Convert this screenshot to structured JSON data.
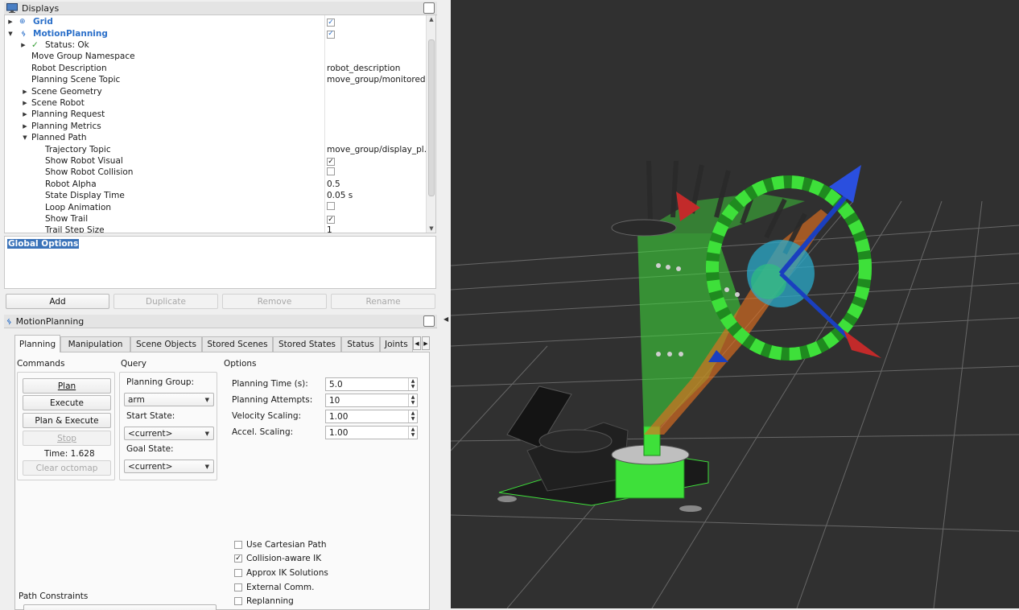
{
  "displays_panel": {
    "title": "Displays",
    "rows": [
      {
        "label": "Grid",
        "value": "✓",
        "blue": true,
        "kind": "check-blue"
      },
      {
        "label": "MotionPlanning",
        "value": "✓",
        "blue": true,
        "kind": "check-blue"
      },
      {
        "label": "Status: Ok",
        "value": ""
      },
      {
        "label": "Move Group Namespace",
        "value": ""
      },
      {
        "label": "Robot Description",
        "value": "robot_description"
      },
      {
        "label": "Planning Scene Topic",
        "value": "move_group/monitored..."
      },
      {
        "label": "Scene Geometry",
        "value": ""
      },
      {
        "label": "Scene Robot",
        "value": ""
      },
      {
        "label": "Planning Request",
        "value": ""
      },
      {
        "label": "Planning Metrics",
        "value": ""
      },
      {
        "label": "Planned Path",
        "value": ""
      },
      {
        "label": "Trajectory Topic",
        "value": "move_group/display_pl..."
      },
      {
        "label": "Show Robot Visual",
        "value": "✓",
        "kind": "check"
      },
      {
        "label": "Show Robot Collision",
        "value": "",
        "kind": "check"
      },
      {
        "label": "Robot Alpha",
        "value": "0.5"
      },
      {
        "label": "State Display Time",
        "value": "0.05 s"
      },
      {
        "label": "Loop Animation",
        "value": "",
        "kind": "check"
      },
      {
        "label": "Show Trail",
        "value": "✓",
        "kind": "check"
      },
      {
        "label": "Trail Step Size",
        "value": "1"
      }
    ],
    "description_selected": "Global Options",
    "buttons": {
      "add": "Add",
      "duplicate": "Duplicate",
      "remove": "Remove",
      "rename": "Rename"
    }
  },
  "motion_planning": {
    "title": "MotionPlanning",
    "tabs": [
      "Planning",
      "Manipulation",
      "Scene Objects",
      "Stored Scenes",
      "Stored States",
      "Status",
      "Joints"
    ],
    "active_tab": "Planning",
    "commands": {
      "title": "Commands",
      "plan": "Plan",
      "execute": "Execute",
      "plan_execute": "Plan & Execute",
      "stop": "Stop",
      "time": "Time: 1.628",
      "clear_octomap": "Clear octomap"
    },
    "query": {
      "title": "Query",
      "planning_group_label": "Planning Group:",
      "planning_group": "arm",
      "start_state_label": "Start State:",
      "start_state": "<current>",
      "goal_state_label": "Goal State:",
      "goal_state": "<current>"
    },
    "options": {
      "title": "Options",
      "planning_time_label": "Planning Time (s):",
      "planning_time": "5.0",
      "planning_attempts_label": "Planning Attempts:",
      "planning_attempts": "10",
      "velocity_scaling_label": "Velocity Scaling:",
      "velocity_scaling": "1.00",
      "accel_scaling_label": "Accel. Scaling:",
      "accel_scaling": "1.00",
      "checkboxes": [
        {
          "label": "Use Cartesian Path",
          "checked": false
        },
        {
          "label": "Collision-aware IK",
          "checked": true
        },
        {
          "label": "Approx IK Solutions",
          "checked": false
        },
        {
          "label": "External Comm.",
          "checked": false
        },
        {
          "label": "Replanning",
          "checked": false
        }
      ]
    },
    "path_constraints_label": "Path Constraints"
  },
  "colors": {
    "viewport_bg": "#303030",
    "robot_green": "#3ee03a",
    "accent_blue": "#2a6fc9",
    "selection_blue": "#3b73b9"
  }
}
